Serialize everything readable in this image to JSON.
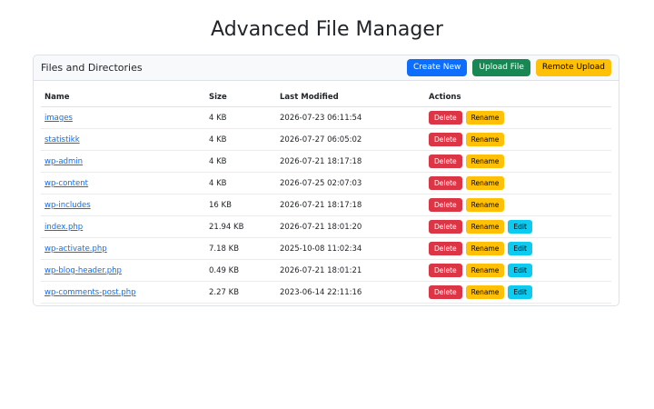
{
  "title": "Advanced File Manager",
  "card": {
    "title": "Files and Directories",
    "buttons": {
      "create_new": "Create New",
      "upload_file": "Upload File",
      "remote_upload": "Remote Upload"
    }
  },
  "table": {
    "headers": {
      "name": "Name",
      "size": "Size",
      "modified": "Last Modified",
      "actions": "Actions"
    },
    "action_labels": {
      "delete": "Delete",
      "rename": "Rename",
      "edit": "Edit"
    },
    "rows": [
      {
        "name": "images",
        "size": "4 KB",
        "modified": "2026-07-23 06:11:54",
        "editable": false
      },
      {
        "name": "statistikk",
        "size": "4 KB",
        "modified": "2026-07-27 06:05:02",
        "editable": false
      },
      {
        "name": "wp-admin",
        "size": "4 KB",
        "modified": "2026-07-21 18:17:18",
        "editable": false
      },
      {
        "name": "wp-content",
        "size": "4 KB",
        "modified": "2026-07-25 02:07:03",
        "editable": false
      },
      {
        "name": "wp-includes",
        "size": "16 KB",
        "modified": "2026-07-21 18:17:18",
        "editable": false
      },
      {
        "name": "index.php",
        "size": "21.94 KB",
        "modified": "2026-07-21 18:01:20",
        "editable": true
      },
      {
        "name": "wp-activate.php",
        "size": "7.18 KB",
        "modified": "2025-10-08 11:02:34",
        "editable": true
      },
      {
        "name": "wp-blog-header.php",
        "size": "0.49 KB",
        "modified": "2026-07-21 18:01:21",
        "editable": true
      },
      {
        "name": "wp-comments-post.php",
        "size": "2.27 KB",
        "modified": "2023-06-14 22:11:16",
        "editable": true
      },
      {
        "name": "",
        "size": "",
        "modified": "",
        "editable": true
      }
    ]
  },
  "colors": {
    "primary": "#0d6efd",
    "success": "#198754",
    "warning": "#ffc107",
    "danger": "#dc3545",
    "info": "#0dcaf0"
  }
}
